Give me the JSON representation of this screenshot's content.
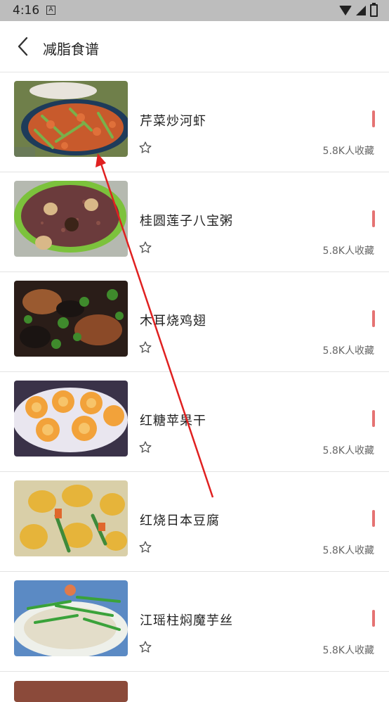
{
  "status": {
    "time": "4:16",
    "a_icon": "A"
  },
  "header": {
    "title": "减脂食谱"
  },
  "colors": {
    "accent": "#e57373",
    "annotation": "#e02020"
  },
  "recipes": [
    {
      "title": "芹菜炒河虾",
      "favorites": "5.8K人收藏",
      "image": "shrimp-celery"
    },
    {
      "title": "桂圆莲子八宝粥",
      "favorites": "5.8K人收藏",
      "image": "eight-treasure-porridge"
    },
    {
      "title": "木耳烧鸡翅",
      "favorites": "5.8K人收藏",
      "image": "fungus-chicken-wings"
    },
    {
      "title": "红糖苹果干",
      "favorites": "5.8K人收藏",
      "image": "brown-sugar-apple"
    },
    {
      "title": "红烧日本豆腐",
      "favorites": "5.8K人收藏",
      "image": "braised-japanese-tofu"
    },
    {
      "title": "江瑶柱焖魔芋丝",
      "favorites": "5.8K人收藏",
      "image": "scallop-konjac"
    }
  ]
}
